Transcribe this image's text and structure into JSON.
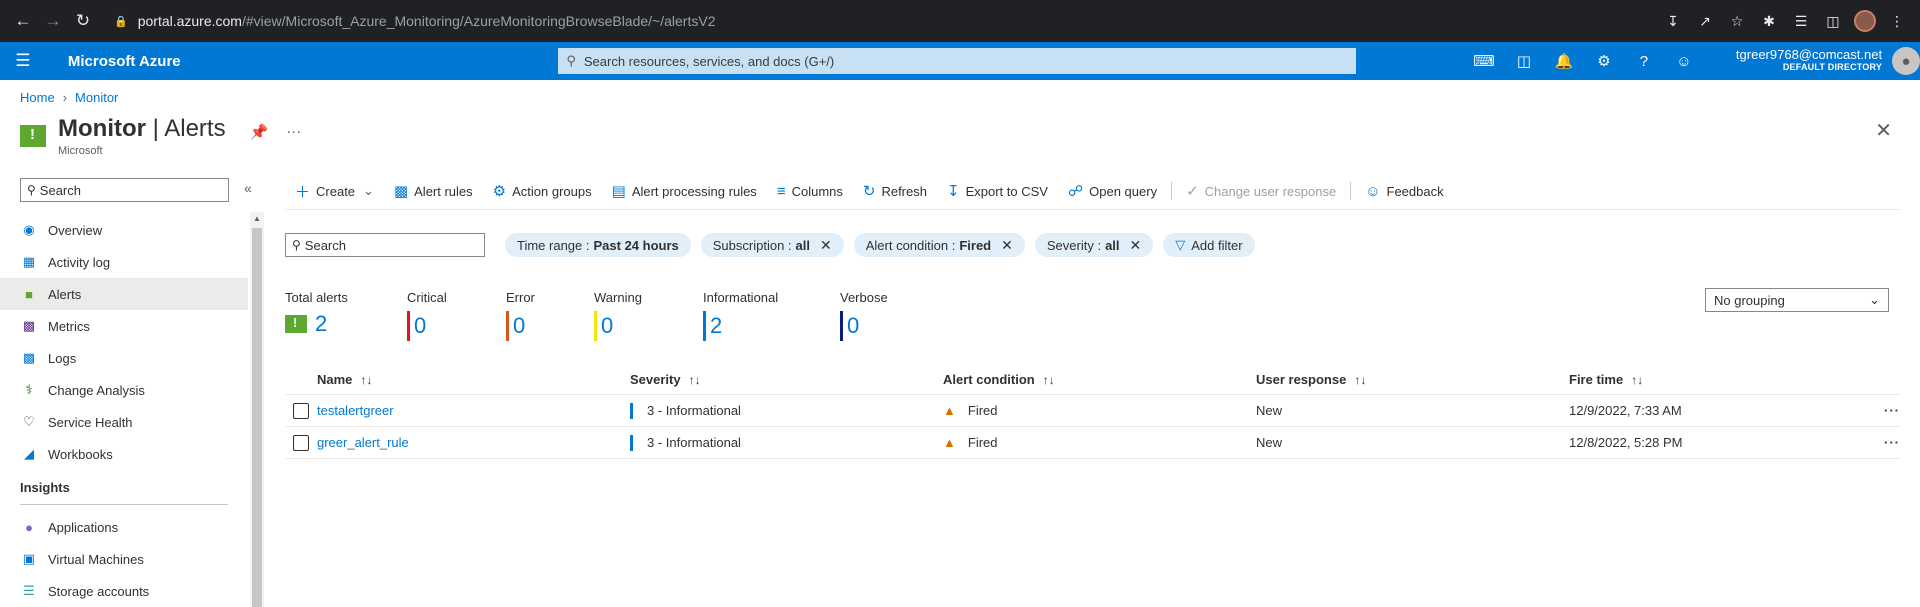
{
  "browser": {
    "url_host": "portal.azure.com",
    "url_path": "/#view/Microsoft_Azure_Monitoring/AzureMonitoringBrowseBlade/~/alertsV2"
  },
  "topbar": {
    "brand": "Microsoft Azure",
    "search_placeholder": "Search resources, services, and docs (G+/)",
    "account_email": "tgreer9768@comcast.net",
    "account_directory": "DEFAULT DIRECTORY"
  },
  "breadcrumb": {
    "home": "Home",
    "monitor": "Monitor"
  },
  "title": {
    "main": "Monitor",
    "sep": " | ",
    "sub_title": "Alerts",
    "subtitle": "Microsoft"
  },
  "sidebar": {
    "search_placeholder": "Search",
    "items": [
      {
        "label": "Overview",
        "icon": "overview-icon"
      },
      {
        "label": "Activity log",
        "icon": "activity-log-icon"
      },
      {
        "label": "Alerts",
        "icon": "alerts-icon"
      },
      {
        "label": "Metrics",
        "icon": "metrics-icon"
      },
      {
        "label": "Logs",
        "icon": "logs-icon"
      },
      {
        "label": "Change Analysis",
        "icon": "change-analysis-icon"
      },
      {
        "label": "Service Health",
        "icon": "service-health-icon"
      },
      {
        "label": "Workbooks",
        "icon": "workbooks-icon"
      }
    ],
    "section": "Insights",
    "insight_items": [
      {
        "label": "Applications"
      },
      {
        "label": "Virtual Machines"
      },
      {
        "label": "Storage accounts"
      }
    ]
  },
  "toolbar": {
    "create": "Create",
    "alert_rules": "Alert rules",
    "action_groups": "Action groups",
    "alert_processing_rules": "Alert processing rules",
    "columns": "Columns",
    "refresh": "Refresh",
    "export_csv": "Export to CSV",
    "open_query": "Open query",
    "change_user_response": "Change user response",
    "feedback": "Feedback"
  },
  "filters": {
    "search_placeholder": "Search",
    "time_range_label": "Time range :",
    "time_range_value": "Past 24 hours",
    "subscription_label": "Subscription :",
    "subscription_value": "all",
    "condition_label": "Alert condition :",
    "condition_value": "Fired",
    "severity_label": "Severity :",
    "severity_value": "all",
    "add_filter": "Add filter"
  },
  "summary": {
    "total_label": "Total alerts",
    "total": "2",
    "critical_label": "Critical",
    "critical": "0",
    "error_label": "Error",
    "error": "0",
    "warning_label": "Warning",
    "warning": "0",
    "informational_label": "Informational",
    "informational": "2",
    "verbose_label": "Verbose",
    "verbose": "0",
    "colors": {
      "critical": "#e81123",
      "error": "#d9591a",
      "warning": "#fce100",
      "informational": "#0078d4",
      "verbose": "#0b1f7c"
    }
  },
  "grouping": {
    "selected": "No grouping"
  },
  "table": {
    "headers": {
      "name": "Name",
      "severity": "Severity",
      "condition": "Alert condition",
      "response": "User response",
      "time": "Fire time"
    },
    "rows": [
      {
        "name": "testalertgreer",
        "severity": "3 - Informational",
        "condition": "Fired",
        "response": "New",
        "time": "12/9/2022, 7:33 AM"
      },
      {
        "name": "greer_alert_rule",
        "severity": "3 - Informational",
        "condition": "Fired",
        "response": "New",
        "time": "12/8/2022, 5:28 PM"
      }
    ]
  }
}
